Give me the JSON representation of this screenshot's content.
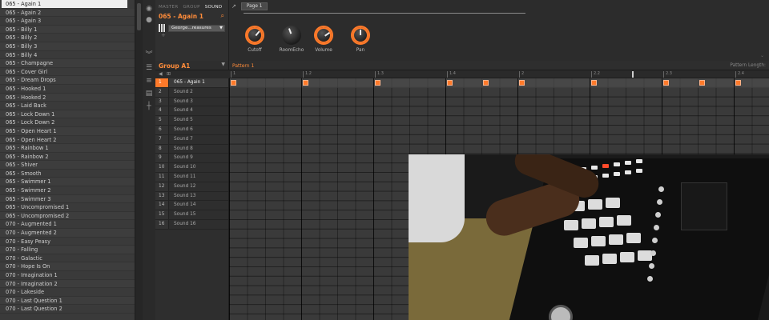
{
  "browser": {
    "items": [
      "065 - Again 1",
      "065 - Again 2",
      "065 - Again 3",
      "065 - Billy 1",
      "065 - Billy 2",
      "065 - Billy 3",
      "065 - Billy 4",
      "065 - Champagne",
      "065 - Cover Girl",
      "065 - Dream Drops",
      "065 - Hooked 1",
      "065 - Hooked 2",
      "065 - Laid Back",
      "065 - Lock Down 1",
      "065 - Lock Down 2",
      "065 - Open Heart 1",
      "065 - Open Heart 2",
      "065 - Rainbow 1",
      "065 - Rainbow 2",
      "065 - Shiver",
      "065 - Smooth",
      "065 - Swimmer 1",
      "065 - Swimmer 2",
      "065 - Swimmer 3",
      "065 - Uncompromised 1",
      "065 - Uncompromised 2",
      "070 - Augmented 1",
      "070 - Augmented 2",
      "070 - Easy Peasy",
      "070 - Falling",
      "070 - Galactic",
      "070 - Hope Is On",
      "070 - Imagination 1",
      "070 - Imagination 2",
      "070 - Lakeside",
      "070 - Last Question 1",
      "070 - Last Question 2"
    ],
    "selected_index": 0
  },
  "channel": {
    "tabs": [
      "MASTER",
      "GROUP",
      "SOUND"
    ],
    "active_tab": "SOUND",
    "title": "065 - Again 1",
    "preset": "George...reasures",
    "search_icon": "search-icon",
    "plus": "+"
  },
  "plugin": {
    "page_label": "Page 1",
    "knobs": [
      {
        "label": "Cutoff",
        "active": true,
        "angle": 40
      },
      {
        "label": "RoomEcho",
        "active": false,
        "angle": -20
      },
      {
        "label": "Volume",
        "active": true,
        "angle": 55
      },
      {
        "label": "Pan",
        "active": true,
        "angle": 0
      }
    ]
  },
  "group": {
    "title": "Group A1"
  },
  "pattern": {
    "title": "Pattern 1",
    "length_label": "Pattern Length:",
    "ruler": [
      "1",
      "1.2",
      "1.3",
      "1.4",
      "2",
      "2.2",
      "2.3",
      "2.4"
    ],
    "notes_steps": [
      0,
      4,
      8,
      12,
      14,
      16,
      20,
      24,
      26,
      28
    ]
  },
  "sounds": [
    {
      "num": "1",
      "name": "065 - Again 1"
    },
    {
      "num": "2",
      "name": "Sound 2"
    },
    {
      "num": "3",
      "name": "Sound 3"
    },
    {
      "num": "4",
      "name": "Sound 4"
    },
    {
      "num": "5",
      "name": "Sound 5"
    },
    {
      "num": "6",
      "name": "Sound 6"
    },
    {
      "num": "7",
      "name": "Sound 7"
    },
    {
      "num": "8",
      "name": "Sound 8"
    },
    {
      "num": "9",
      "name": "Sound 9"
    },
    {
      "num": "10",
      "name": "Sound 10"
    },
    {
      "num": "11",
      "name": "Sound 11"
    },
    {
      "num": "12",
      "name": "Sound 12"
    },
    {
      "num": "13",
      "name": "Sound 13"
    },
    {
      "num": "14",
      "name": "Sound 14"
    },
    {
      "num": "15",
      "name": "Sound 15"
    },
    {
      "num": "16",
      "name": "Sound 16"
    }
  ],
  "colors": {
    "accent": "#ff7a2a",
    "background": "#2a2a2a"
  }
}
